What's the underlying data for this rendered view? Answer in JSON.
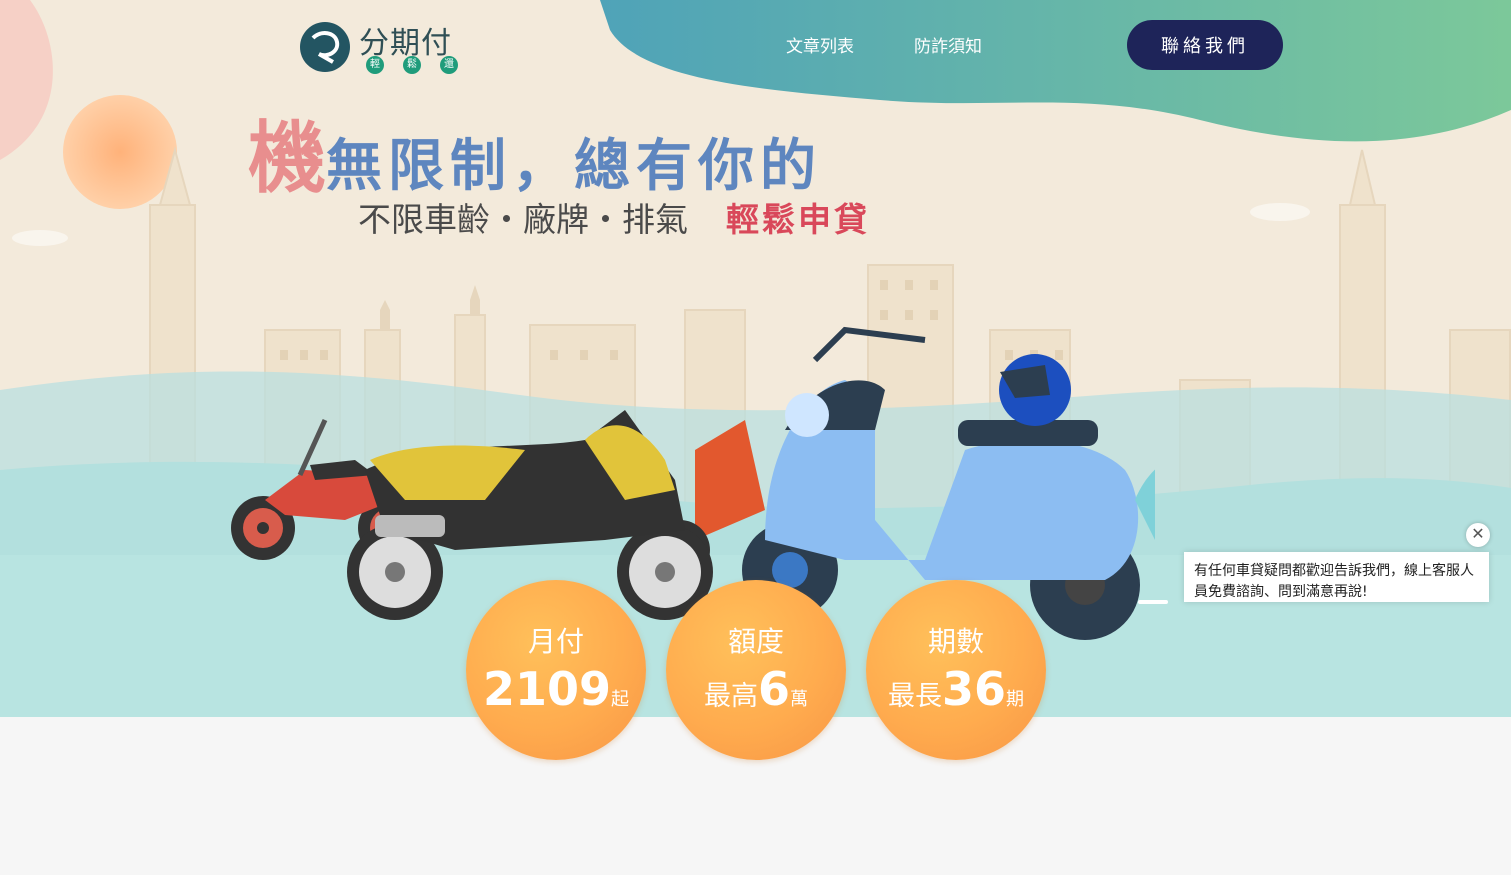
{
  "logo": {
    "name": "分期付",
    "subs": [
      "輕",
      "鬆",
      "還"
    ]
  },
  "nav": {
    "items": [
      "文章列表",
      "防詐須知"
    ],
    "contact_label": "聯絡我們"
  },
  "headline": {
    "big": "機",
    "rest": "無限制，總有你的"
  },
  "subline": {
    "text": "不限車齡・廠牌・排氣",
    "highlight": "輕鬆申貸"
  },
  "stats": [
    {
      "title": "月付",
      "prefix": "",
      "number": "2109",
      "suffix": "起"
    },
    {
      "title": "額度",
      "prefix": "最高",
      "number": "6",
      "suffix": "萬"
    },
    {
      "title": "期數",
      "prefix": "最長",
      "number": "36",
      "suffix": "期"
    }
  ],
  "chat": {
    "message": "有任何車貸疑問都歡迎告訴我們，線上客服人員免費諮詢、問到滿意再說!"
  },
  "colors": {
    "nav_button": "#1e2459",
    "stat_orange": "#ffab4e",
    "headline_blue": "#5e86bf",
    "highlight_red": "#d9485a"
  }
}
